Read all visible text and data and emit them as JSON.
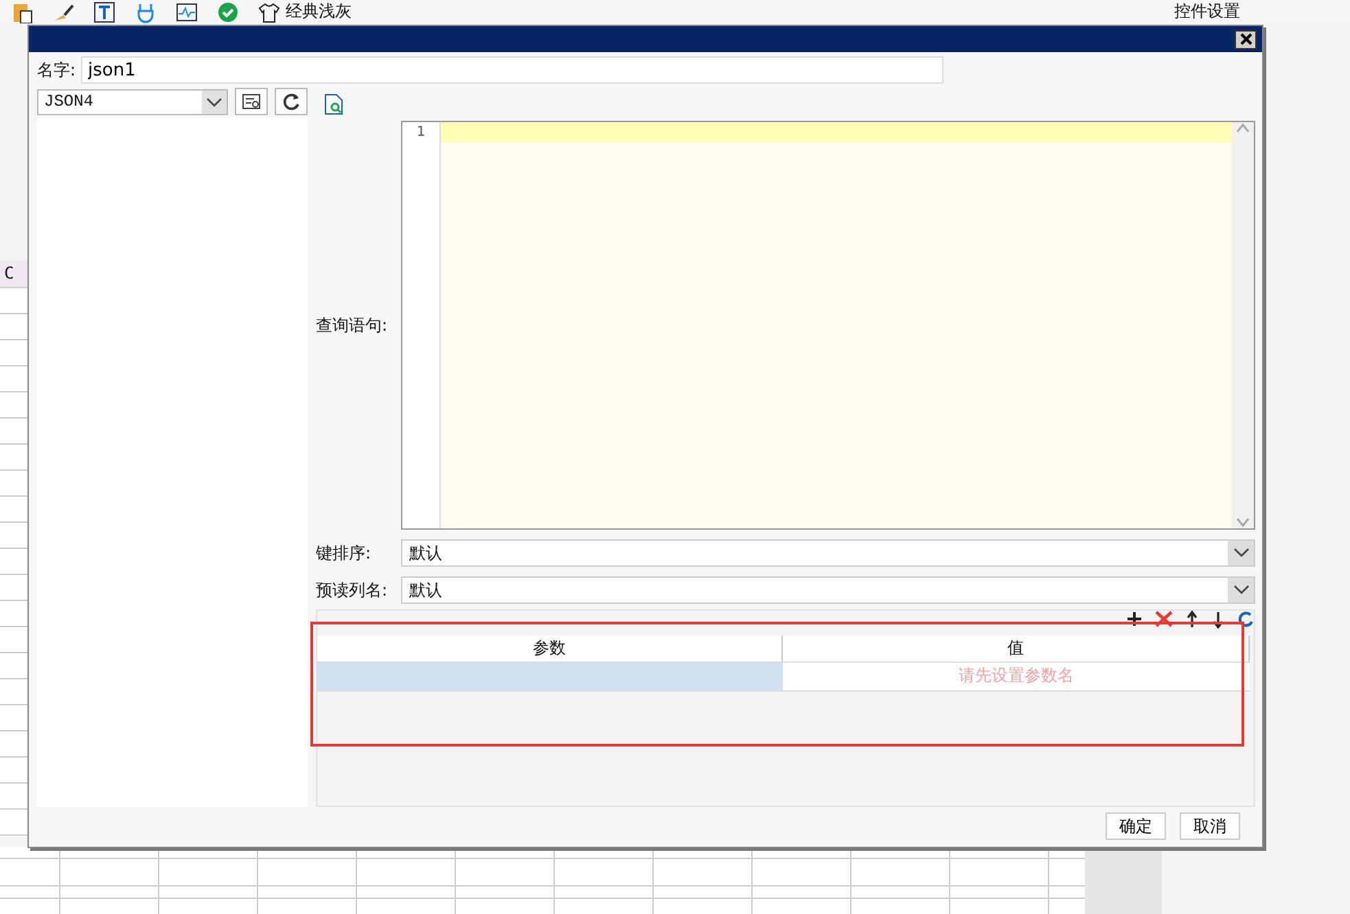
{
  "app": {
    "toolbar": {
      "theme_label": "经典浅灰"
    },
    "side_panel": {
      "title": "控件设置"
    },
    "sheet": {
      "column_header": "C"
    }
  },
  "dialog": {
    "name_label": "名字:",
    "name_value": "json1",
    "source": "JSON4",
    "query_label": "查询语句:",
    "line_numbers": [
      "1"
    ],
    "key_sort_label": "键排序:",
    "key_sort_value": "默认",
    "preview_label": "预读列名:",
    "preview_value": "默认",
    "params": {
      "columns": [
        "参数",
        "值"
      ],
      "rows": [
        {
          "selected": true,
          "placeholder": "请先设置参数名"
        }
      ]
    },
    "buttons": [
      "确定",
      "取消"
    ]
  }
}
